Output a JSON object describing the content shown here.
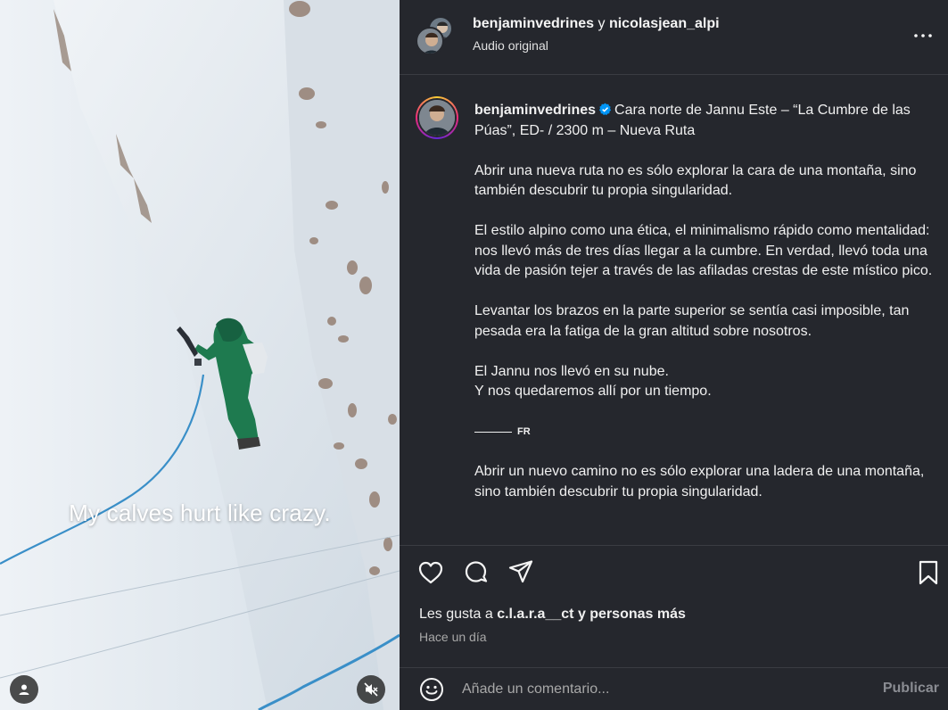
{
  "media": {
    "overlay_text": "My calves hurt like crazy.",
    "user_tags_icon": "person-icon",
    "mute_icon": "muted-speaker-icon"
  },
  "header": {
    "user1": "benjaminvedrines",
    "joiner": "y",
    "user2": "nicolasjean_alpi",
    "audio": "Audio original",
    "more_icon": "ellipsis-icon"
  },
  "caption": {
    "username": "benjaminvedrines",
    "verified_icon": "verified-badge-icon",
    "first_line": "Cara norte de Jannu Este – “La Cumbre de las Púas”, ED- / 2300 m – Nueva Ruta",
    "paragraphs": [
      "Abrir una nueva ruta no es sólo explorar la cara de una montaña, sino también descubrir tu propia singularidad.",
      "El estilo alpino como una ética, el minimalismo rápido como mentalidad: nos llevó más de tres días llegar a la cumbre. En verdad, llevó toda una vida de pasión tejer a través de las afiladas crestas de este místico pico.",
      "Levantar los brazos en la parte superior se sentía casi imposible, tan pesada era la fatiga de la gran altitud sobre nosotros.",
      "El Jannu nos llevó en su nube.",
      "Y nos quedaremos allí por un tiempo."
    ],
    "fr_label": "FR",
    "fr_paragraph": "Abrir un nuevo camino no es sólo explorar una ladera de una montaña, sino también descubrir tu propia singularidad."
  },
  "actions": {
    "like_icon": "heart-icon",
    "comment_icon": "comment-bubble-icon",
    "share_icon": "paper-plane-icon",
    "save_icon": "bookmark-icon",
    "likes_prefix": "Les gusta a",
    "likes_user": "c.l.a.r.a__ct",
    "likes_suffix": "y personas más",
    "time": "Hace un día"
  },
  "comment": {
    "emoji_icon": "smiley-icon",
    "placeholder": "Añade un comentario...",
    "publish_label": "Publicar"
  },
  "colors": {
    "panel_bg": "#25272d",
    "divider": "#3a3c42",
    "verified_blue": "#0095f6",
    "publish_disabled": "#8a8c92"
  }
}
